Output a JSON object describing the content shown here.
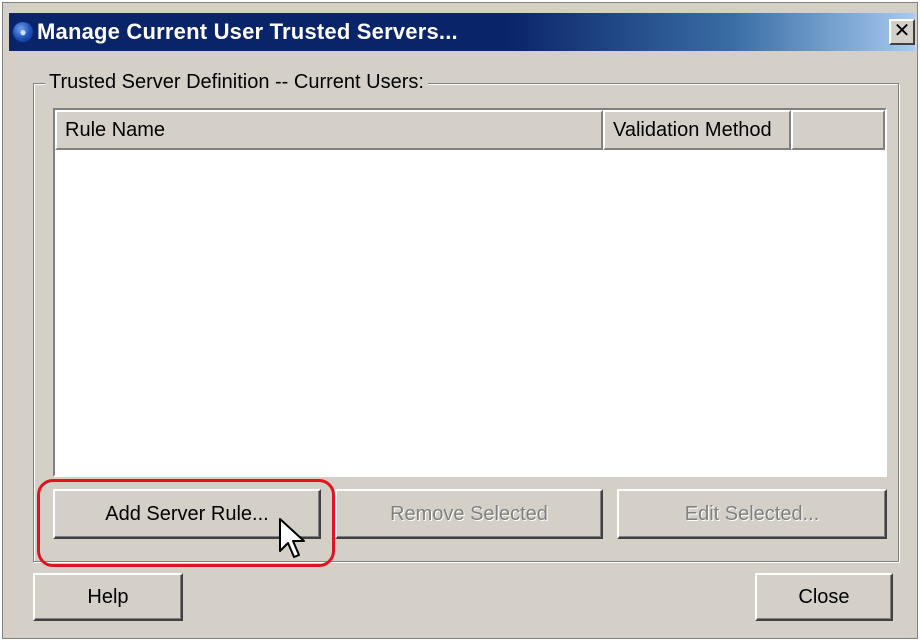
{
  "window": {
    "title": "Manage Current User Trusted Servers...",
    "close_glyph": "✕",
    "title_icon": "app-globe-icon"
  },
  "group": {
    "label": "Trusted Server Definition -- Current Users:"
  },
  "list": {
    "columns": [
      "Rule Name",
      "Validation Method",
      ""
    ],
    "rows": []
  },
  "buttons": {
    "add_server_rule": "Add Server Rule...",
    "remove_selected": "Remove Selected",
    "edit_selected": "Edit Selected...",
    "help": "Help",
    "close": "Close"
  },
  "annotation": {
    "highlight_color": "#e0141e",
    "highlighted_button": "Add Server Rule..."
  },
  "colors": {
    "titlebar_active": "#0a246a",
    "dialog_face": "#d4d0c8"
  }
}
